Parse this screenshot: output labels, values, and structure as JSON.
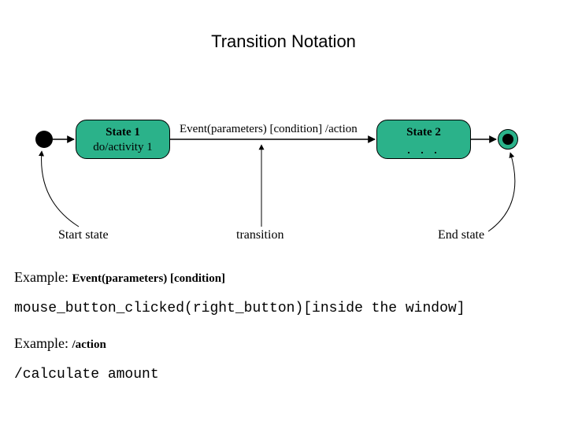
{
  "title": "Transition Notation",
  "state1": {
    "name": "State 1",
    "activity": "do/activity 1"
  },
  "state2": {
    "name": "State 2",
    "dots": ". . ."
  },
  "transition_text": "Event(parameters) [condition] /action",
  "labels": {
    "start": "Start state",
    "transition": "transition",
    "end": "End state"
  },
  "example1": {
    "prefix": "Example: ",
    "bold": "Event(parameters) [condition]"
  },
  "code1": "mouse_button_clicked(right_button)[inside the window]",
  "example2": {
    "prefix": "Example: ",
    "bold": "/action"
  },
  "code2": "/calculate amount"
}
